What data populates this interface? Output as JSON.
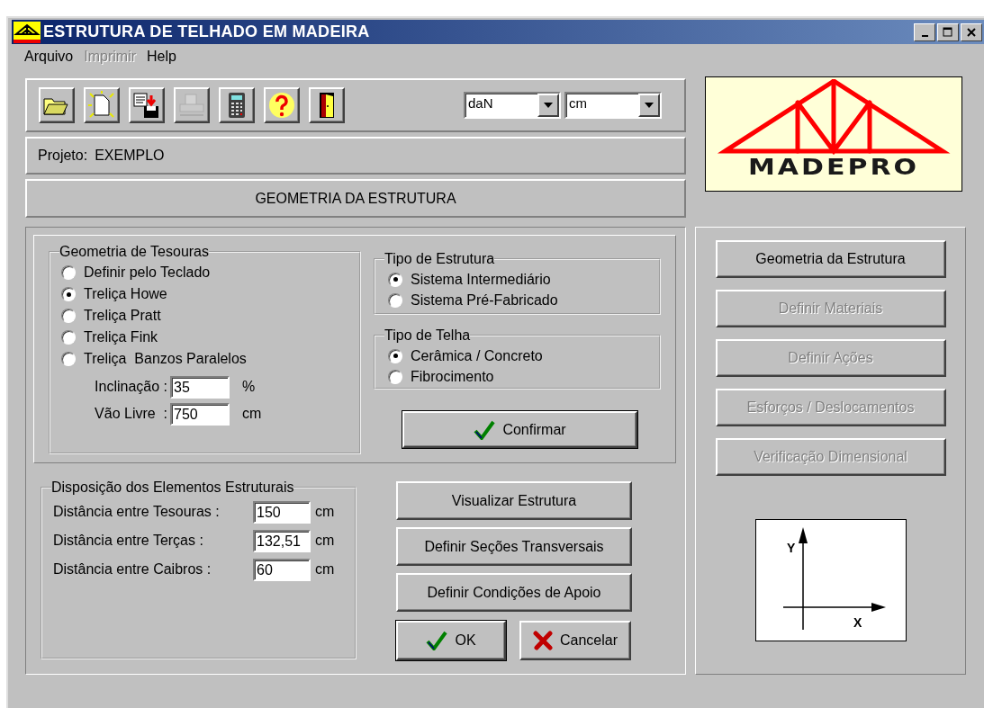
{
  "window": {
    "title": "ESTRUTURA DE TELHADO EM MADEIRA"
  },
  "menu": [
    {
      "label": "Arquivo",
      "disabled": false
    },
    {
      "label": "Imprimir",
      "disabled": true
    },
    {
      "label": "Help",
      "disabled": false
    }
  ],
  "toolbar": [
    {
      "kind": "open",
      "disabled": false
    },
    {
      "kind": "new",
      "disabled": false
    },
    {
      "kind": "save",
      "disabled": false
    },
    {
      "kind": "print",
      "disabled": true
    },
    {
      "kind": "calculator",
      "disabled": false
    },
    {
      "kind": "help",
      "disabled": false
    },
    {
      "kind": "exit",
      "disabled": false
    }
  ],
  "units": [
    {
      "value": "daN"
    },
    {
      "value": "cm"
    }
  ],
  "project": {
    "label": "Projeto:",
    "value": "EXEMPLO"
  },
  "section_header": "GEOMETRIA DA ESTRUTURA",
  "logo": {
    "text": "MADEPRO"
  },
  "geometria_tesouras": {
    "title": "Geometria de Tesouras",
    "options": [
      {
        "label": "Definir pelo Teclado",
        "selected": false
      },
      {
        "label": "Treliça Howe",
        "selected": true
      },
      {
        "label": "Treliça Pratt",
        "selected": false
      },
      {
        "label": "Treliça Fink",
        "selected": false
      },
      {
        "label": "Treliça  Banzos Paralelos",
        "selected": false
      }
    ],
    "fields": [
      {
        "label": "Inclinação :",
        "value": "35",
        "unit": "%"
      },
      {
        "label": "Vão Livre  :",
        "value": "750",
        "unit": "cm"
      }
    ]
  },
  "tipo_estrutura": {
    "title": "Tipo de Estrutura",
    "options": [
      {
        "label": "Sistema Intermediário",
        "selected": true
      },
      {
        "label": "Sistema Pré-Fabricado",
        "selected": false
      }
    ]
  },
  "tipo_telha": {
    "title": "Tipo de Telha",
    "options": [
      {
        "label": "Cerâmica / Concreto",
        "selected": true
      },
      {
        "label": "Fibrocimento",
        "selected": false
      }
    ]
  },
  "confirm_button": {
    "label": "Confirmar"
  },
  "disposicao": {
    "title": "Disposição dos Elementos Estruturais",
    "fields": [
      {
        "label": "Distância entre Tesouras :",
        "value": "150",
        "unit": "cm"
      },
      {
        "label": "Distância entre Terças :",
        "value": "132,51",
        "unit": "cm"
      },
      {
        "label": "Distância entre Caibros :",
        "value": "60",
        "unit": "cm"
      }
    ]
  },
  "action_buttons": [
    {
      "label": "Visualizar Estrutura"
    },
    {
      "label": "Definir Seções Transversais"
    },
    {
      "label": "Definir Condições de Apoio"
    }
  ],
  "ok_button": {
    "label": "OK"
  },
  "cancel_button": {
    "label": "Cancelar"
  },
  "steps": [
    {
      "label": "Geometria da Estrutura",
      "disabled": false
    },
    {
      "label": "Definir Materiais",
      "disabled": true
    },
    {
      "label": "Definir Ações",
      "disabled": true
    },
    {
      "label": "Esforços / Deslocamentos",
      "disabled": true
    },
    {
      "label": "Verificação Dimensional",
      "disabled": true
    }
  ],
  "axes": {
    "y_label": "Y",
    "x_label": "X"
  }
}
